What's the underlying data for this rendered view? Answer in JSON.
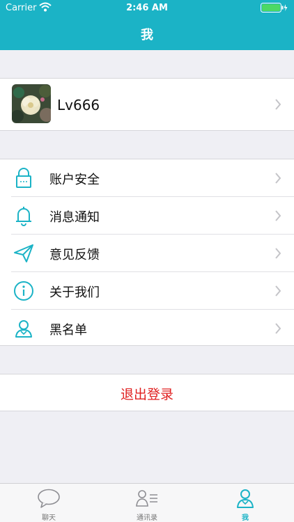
{
  "status_bar": {
    "carrier": "Carrier",
    "time": "2:46 AM"
  },
  "nav": {
    "title": "我"
  },
  "profile": {
    "name": "Lv666"
  },
  "menu": {
    "items": [
      {
        "label": "账户安全",
        "icon": "lock-icon"
      },
      {
        "label": "消息通知",
        "icon": "bell-icon"
      },
      {
        "label": "意见反馈",
        "icon": "paper-plane-icon"
      },
      {
        "label": "关于我们",
        "icon": "info-icon"
      },
      {
        "label": "黑名单",
        "icon": "person-icon"
      }
    ]
  },
  "logout": {
    "label": "退出登录"
  },
  "tabbar": {
    "tabs": [
      {
        "label": "聊天",
        "icon": "chat-bubble-icon"
      },
      {
        "label": "通讯录",
        "icon": "contacts-icon"
      },
      {
        "label": "我",
        "icon": "me-icon",
        "active": true
      }
    ]
  },
  "colors": {
    "accent": "#1bb3c6",
    "logout": "#e02020",
    "background": "#efeff4"
  }
}
